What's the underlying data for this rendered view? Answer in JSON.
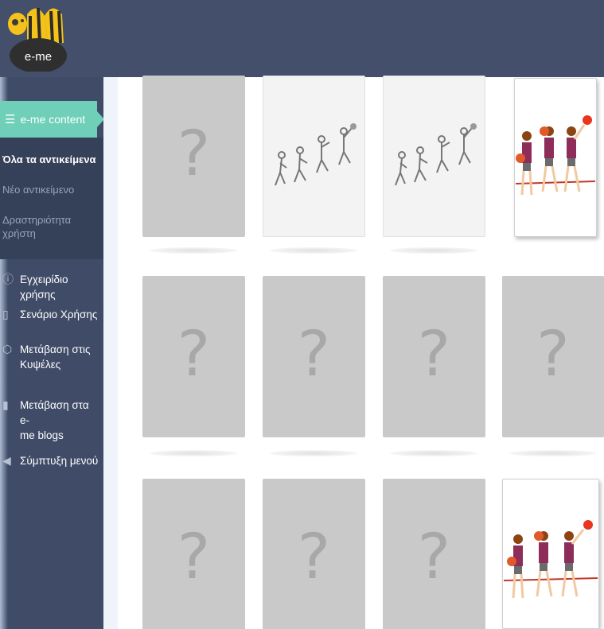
{
  "brand": {
    "logo_text": "e-me"
  },
  "sidebar": {
    "active_item": {
      "label": "e-me content",
      "icon": "list-icon"
    },
    "sub_items": [
      {
        "label_lines": [
          "Όλα τα αντικείμενα"
        ],
        "bold": true
      },
      {
        "label_lines": [
          "Νέο αντικείμενο"
        ],
        "bold": false
      },
      {
        "label_lines": [
          "Δραστηριότητα",
          "χρήστη"
        ],
        "bold": false
      }
    ],
    "items": [
      {
        "label_lines": [
          "Εγχειρίδιο χρήσης"
        ],
        "icon": "help-icon"
      },
      {
        "label_lines": [
          "Σενάριο Χρήσης"
        ],
        "icon": "document-icon"
      },
      {
        "label_lines": [
          "Μετάβαση στις",
          "Κυψέλες"
        ],
        "icon": "hexagon-icon"
      },
      {
        "label_lines": [
          "Μετάβαση στα e-",
          "me blogs"
        ],
        "icon": "blog-icon"
      },
      {
        "label_lines": [
          "Σύμπτυξη μενού"
        ],
        "icon": "collapse-icon"
      }
    ]
  },
  "grid": {
    "placeholder_symbol": "?",
    "cards": [
      {
        "kind": "hidden"
      },
      {
        "kind": "sketch"
      },
      {
        "kind": "sketch"
      },
      {
        "kind": "color"
      },
      {
        "kind": "hidden"
      },
      {
        "kind": "hidden"
      },
      {
        "kind": "hidden"
      },
      {
        "kind": "hidden"
      },
      {
        "kind": "hidden"
      },
      {
        "kind": "hidden"
      },
      {
        "kind": "hidden"
      },
      {
        "kind": "color"
      }
    ]
  },
  "colors": {
    "topbar": "#434f6b",
    "sidebar": "#3f4b67",
    "accent": "#6fcfb9",
    "card": "#c9c9c9"
  }
}
